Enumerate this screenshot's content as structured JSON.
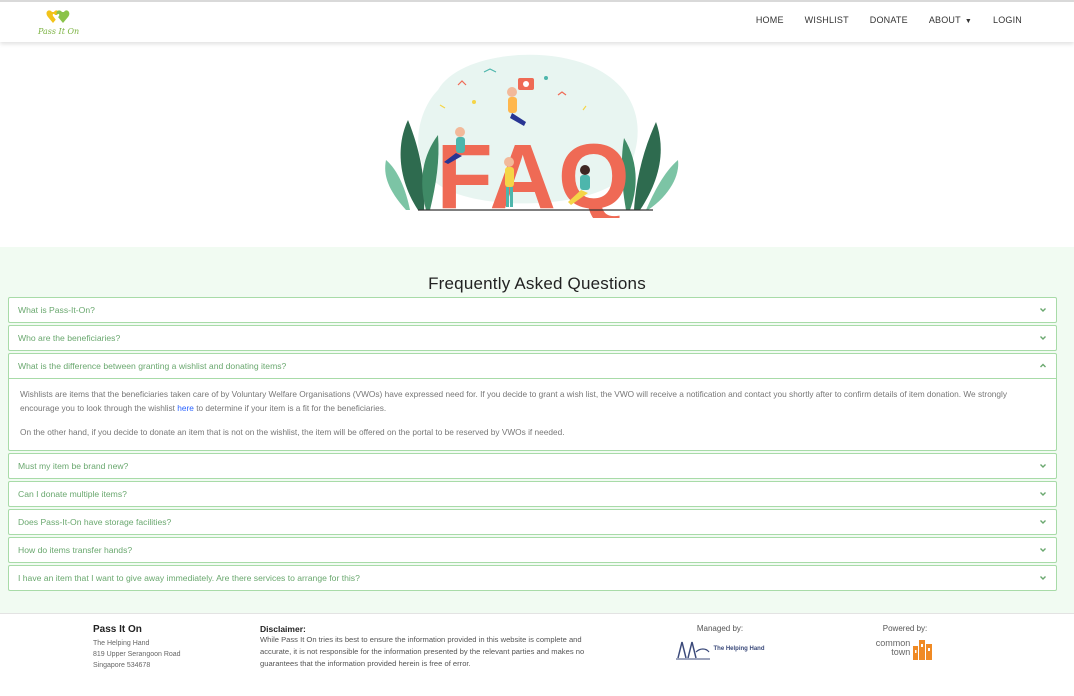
{
  "brand": {
    "logo_text": "Pass It On"
  },
  "nav": {
    "home": "HOME",
    "wishlist": "WISHLIST",
    "donate": "DONATE",
    "about": "ABOUT",
    "login": "LOGIN"
  },
  "hero": {
    "big_text": "FAQ"
  },
  "faq": {
    "title": "Frequently Asked Questions",
    "items": [
      {
        "question": "What is Pass-It-On?",
        "expanded": false
      },
      {
        "question": "Who are the beneficiaries?",
        "expanded": false
      },
      {
        "question": "What is the difference between granting a wishlist and donating items?",
        "expanded": true,
        "answer_p1_before": "Wishlists are items that the beneficiaries taken care of by Voluntary Welfare Organisations (VWOs) have expressed need for. If you decide to grant a wish list, the VWO will receive a notification and contact you shortly after to confirm details of item donation. We strongly encourage you to look through the wishlist ",
        "answer_p1_link": "here",
        "answer_p1_after": " to determine if your item is a fit for the beneficiaries.",
        "answer_p2": "On the other hand, if you decide to donate an item that is not on the wishlist, the item will be offered on the portal to be reserved by VWOs if needed."
      },
      {
        "question": "Must my item be brand new?",
        "expanded": false
      },
      {
        "question": "Can I donate multiple items?",
        "expanded": false
      },
      {
        "question": "Does Pass-It-On have storage facilities?",
        "expanded": false
      },
      {
        "question": "How do items transfer hands?",
        "expanded": false
      },
      {
        "question": "I have an item that I want to give away immediately. Are there services to arrange for this?",
        "expanded": false
      }
    ]
  },
  "footer": {
    "org_name": "Pass It On",
    "org_lines": [
      "The Helping Hand",
      "819 Upper Serangoon Road",
      "Singapore 534678"
    ],
    "disclaimer_title": "Disclaimer:",
    "disclaimer_text": "While Pass It On tries its best to ensure the information provided in this website is complete and accurate, it is not responsible for the information presented by the relevant parties and makes no guarantees that the information provided herein is free of error.",
    "managed_by": "Managed by:",
    "managed_logo_text": "The Helping Hand",
    "powered_by": "Powered by:",
    "powered_logo_line1": "common",
    "powered_logo_line2": "town"
  },
  "colors": {
    "accent_green": "#6aa86f",
    "faq_bg": "#f1fbf2",
    "faq_border": "#a8dba8",
    "faq_letters": "#ef6a55",
    "link_blue": "#2962ff"
  },
  "icons": {
    "accordion_collapsed": "chevron-down-icon",
    "accordion_expanded": "chevron-up-icon",
    "nav_dropdown": "caret-down-icon"
  }
}
